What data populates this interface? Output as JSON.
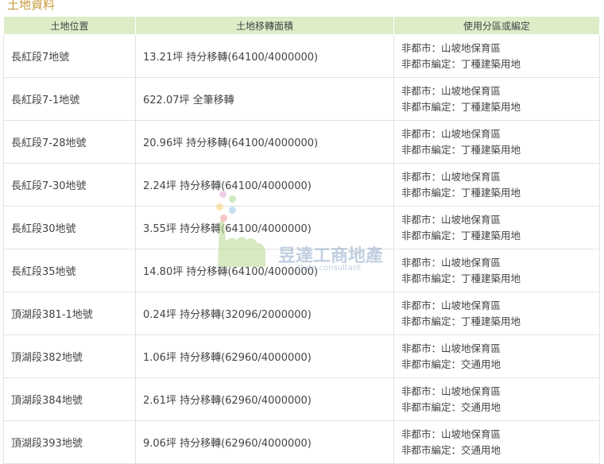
{
  "section": {
    "title": "土地資料"
  },
  "table": {
    "headers": [
      "土地位置",
      "土地移轉面積",
      "使用分區或編定"
    ],
    "rows": [
      {
        "location": "長紅段7地號",
        "area": "13.21坪 持分移轉(64100/4000000)",
        "zone1": "非都市：山坡地保育區",
        "zone2": "非都市編定：丁種建築用地"
      },
      {
        "location": "長紅段7-1地號",
        "area": "622.07坪 全筆移轉",
        "zone1": "非都市：山坡地保育區",
        "zone2": "非都市編定：丁種建築用地"
      },
      {
        "location": "長紅段7-28地號",
        "area": "20.96坪 持分移轉(64100/4000000)",
        "zone1": "非都市：山坡地保育區",
        "zone2": "非都市編定：丁種建築用地"
      },
      {
        "location": "長紅段7-30地號",
        "area": "2.24坪 持分移轉(64100/4000000)",
        "zone1": "非都市：山坡地保育區",
        "zone2": "非都市編定：丁種建築用地"
      },
      {
        "location": "長紅段30地號",
        "area": "3.55坪 持分移轉(64100/4000000)",
        "zone1": "非都市：山坡地保育區",
        "zone2": "非都市編定：丁種建築用地"
      },
      {
        "location": "長紅段35地號",
        "area": "14.80坪 持分移轉(64100/4000000)",
        "zone1": "非都市：山坡地保育區",
        "zone2": "非都市編定：丁種建築用地"
      },
      {
        "location": "頂湖段381-1地號",
        "area": "0.24坪 持分移轉(32096/2000000)",
        "zone1": "非都市：山坡地保育區",
        "zone2": "非都市編定：丁種建築用地"
      },
      {
        "location": "頂湖段382地號",
        "area": "1.06坪 持分移轉(62960/4000000)",
        "zone1": "非都市：山坡地保育區",
        "zone2": "非都市編定：交通用地"
      },
      {
        "location": "頂湖段384地號",
        "area": "2.61坪 持分移轉(62960/4000000)",
        "zone1": "非都市：山坡地保育區",
        "zone2": "非都市編定：交通用地"
      },
      {
        "location": "頂湖段393地號",
        "area": "9.06坪 持分移轉(62960/4000000)",
        "zone1": "非都市：山坡地保育區",
        "zone2": "非都市編定：交通用地"
      }
    ]
  },
  "watermark": {
    "name": "昱達工商地產",
    "sub": "state consultant"
  },
  "colors": {
    "header_bg": "#dcedc8",
    "title": "#c69a3c",
    "border": "#e2e2e2"
  }
}
